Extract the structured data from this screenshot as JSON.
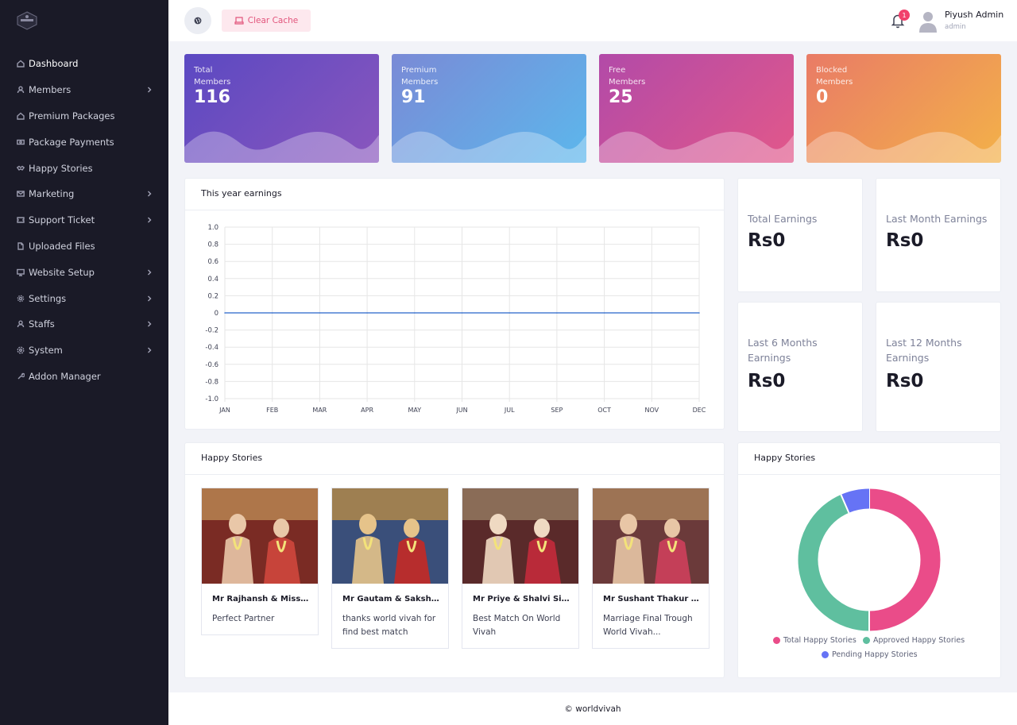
{
  "sidebar": {
    "items": [
      {
        "label": "Dashboard",
        "icon": "home-icon",
        "chevron": false,
        "active": true
      },
      {
        "label": "Members",
        "icon": "user-icon",
        "chevron": true
      },
      {
        "label": "Premium Packages",
        "icon": "home-icon",
        "chevron": false
      },
      {
        "label": "Package Payments",
        "icon": "money-icon",
        "chevron": false
      },
      {
        "label": "Happy Stories",
        "icon": "handshake-icon",
        "chevron": false
      },
      {
        "label": "Marketing",
        "icon": "mail-icon",
        "chevron": true
      },
      {
        "label": "Support Ticket",
        "icon": "ticket-icon",
        "chevron": true
      },
      {
        "label": "Uploaded Files",
        "icon": "file-icon",
        "chevron": false
      },
      {
        "label": "Website Setup",
        "icon": "monitor-icon",
        "chevron": true
      },
      {
        "label": "Settings",
        "icon": "gear-icon",
        "chevron": true
      },
      {
        "label": "Staffs",
        "icon": "user-icon",
        "chevron": true
      },
      {
        "label": "System",
        "icon": "system-gear-icon",
        "chevron": true
      },
      {
        "label": "Addon Manager",
        "icon": "wrench-icon",
        "chevron": false
      }
    ]
  },
  "header": {
    "clear_cache": "Clear Cache",
    "notification_count": "1",
    "user_name": "Piyush Admin",
    "user_role": "admin"
  },
  "stats": [
    {
      "label_line1": "Total",
      "label_line2": "Members",
      "value": "116",
      "colors": [
        "#5b49c2",
        "#8a56bd"
      ]
    },
    {
      "label_line1": "Premium",
      "label_line2": "Members",
      "value": "91",
      "colors": [
        "#7a8ad6",
        "#5cb7ec"
      ]
    },
    {
      "label_line1": "Free",
      "label_line2": "Members",
      "value": "25",
      "colors": [
        "#b24aa8",
        "#e2588a"
      ]
    },
    {
      "label_line1": "Blocked",
      "label_line2": "Members",
      "value": "0",
      "colors": [
        "#e97b66",
        "#f3b149"
      ]
    }
  ],
  "earnings_chart": {
    "title": "This year earnings",
    "chart_data": {
      "type": "line",
      "categories": [
        "JAN",
        "FEB",
        "MAR",
        "APR",
        "MAY",
        "JUN",
        "JUL",
        "SEP",
        "OCT",
        "NOV",
        "DEC"
      ],
      "values": [
        0,
        0,
        0,
        0,
        0,
        0,
        0,
        0,
        0,
        0,
        0
      ],
      "yticks": [
        "1.0",
        "0.8",
        "0.6",
        "0.4",
        "0.2",
        "0",
        "-0.2",
        "-0.4",
        "-0.6",
        "-0.8",
        "-1.0"
      ],
      "ylim": [
        -1.0,
        1.0
      ],
      "grid": true,
      "line_color": "#4a7fd4"
    }
  },
  "earnings": [
    {
      "label": "Total Earnings",
      "value": "Rs0"
    },
    {
      "label": "Last Month Earnings",
      "value": "Rs0"
    },
    {
      "label_line1": "Last 6 Months",
      "label_line2": "Earnings",
      "value": "Rs0"
    },
    {
      "label_line1": "Last 12 Months",
      "label_line2": "Earnings",
      "value": "Rs0"
    }
  ],
  "stories_card": {
    "title": "Happy Stories",
    "items": [
      {
        "name": "Mr Rajhansh & Miss N...",
        "desc": "Perfect Partner"
      },
      {
        "name": "Mr Gautam & Sakshi ...",
        "desc": "thanks world vivah for find best match"
      },
      {
        "name": "Mr Priye & Shalvi Singh",
        "desc": "Best Match On World Vivah"
      },
      {
        "name": "Mr Sushant Thakur & ...",
        "desc": "Marriage Final Trough World Vivah..."
      }
    ]
  },
  "stories_chart": {
    "title": "Happy Stories",
    "chart_data": {
      "type": "pie",
      "labels": [
        "Total Happy Stories",
        "Approved Happy Stories",
        "Pending Happy Stories"
      ],
      "values": [
        50,
        43.5,
        6.5
      ],
      "colors": [
        "#ea4c89",
        "#5fbf9f",
        "#6673f5"
      ]
    }
  },
  "footer": {
    "text": "© worldvivah"
  }
}
